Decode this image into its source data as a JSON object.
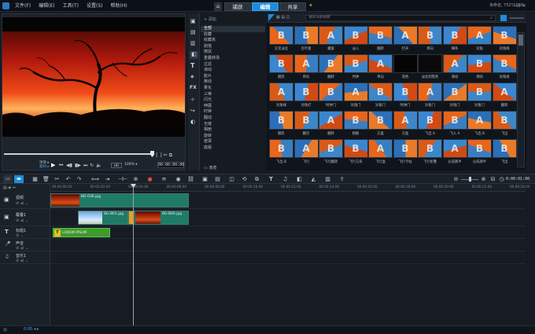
{
  "menu": [
    "文件(F)",
    "编辑(E)",
    "工具(T)",
    "设置(S)",
    "帮助(H)"
  ],
  "mode_tabs": [
    "捕获",
    "编辑",
    "共享"
  ],
  "active_tab": 1,
  "project_status": "未命名, 752*1080",
  "preview": {
    "mode_labels": [
      "项目 ▸",
      "素材 ▸"
    ],
    "timecode": "00:00:00:00",
    "zoom": "100% ▾"
  },
  "library": {
    "add_label": "+ 添加",
    "search_placeholder": "搜索当前视图",
    "browse_label": "浏览",
    "categories": [
      "全部",
      "收藏",
      "收藏夹",
      "剥落",
      "擦拭",
      "重叠转场",
      "过滤",
      "滑动",
      "胶片",
      "推动",
      "果化",
      "三维",
      "闪光",
      "伸展",
      "时钟",
      "翻动",
      "无缝",
      "相册",
      "旋转",
      "遮罩",
      "底版"
    ],
    "selected_category": 0,
    "transitions": [
      "交叉淡化",
      "百叶窗",
      "螺旋",
      "淡入",
      "翻转",
      "打开",
      "单向",
      "横条",
      "对角",
      "对角线",
      "翻页",
      "单向",
      "翻转",
      "时钟",
      "单向",
      "黑色",
      "淡化到黑色",
      "滑动",
      "清除",
      "对角线",
      "对角线",
      "对角打",
      "时钟门",
      "对角门",
      "对角门",
      "时钟门",
      "对角门",
      "对角门",
      "对角门",
      "翻转",
      "翻页",
      "翻页",
      "翻转",
      "相册",
      "方盒",
      "方盒",
      "飞出 A",
      "飞入 A",
      "飞出 B",
      "飞出",
      "飞出 B",
      "飞行",
      "飞行翻转",
      "飞行方块",
      "飞行盒",
      "飞行卡帖",
      "飞行折叠",
      "分成两半",
      "分成两半",
      "飞出"
    ]
  },
  "timeline": {
    "timecode": "0:00:01:00",
    "ruler": [
      "00:00:00:00",
      "00:00:02:00",
      "00:00:04:00",
      "00:00:06:00",
      "00:00:08:00",
      "00:00:10:00",
      "00:00:12:00",
      "00:00:14:00",
      "00:00:16:00",
      "00:00:18:00",
      "00:00:20:00",
      "00:00:22:00",
      "00:00:24:00"
    ],
    "tracks": [
      "视频",
      "覆叠1",
      "标题1",
      "声音",
      "音乐1"
    ],
    "clips": {
      "video_main": "BG-036.jpg",
      "overlay_a": "BG-B01.jpg",
      "overlay_b": "BG-B00.jpg",
      "title": "LOREM IPSUM"
    }
  },
  "status": {
    "left": "0:00 ◂ ▸"
  },
  "colors": {
    "accent": "#1e8cd8",
    "clip_teal": "#1f7a66",
    "title_green": "#3e9a2c",
    "bg": "#161b23"
  }
}
